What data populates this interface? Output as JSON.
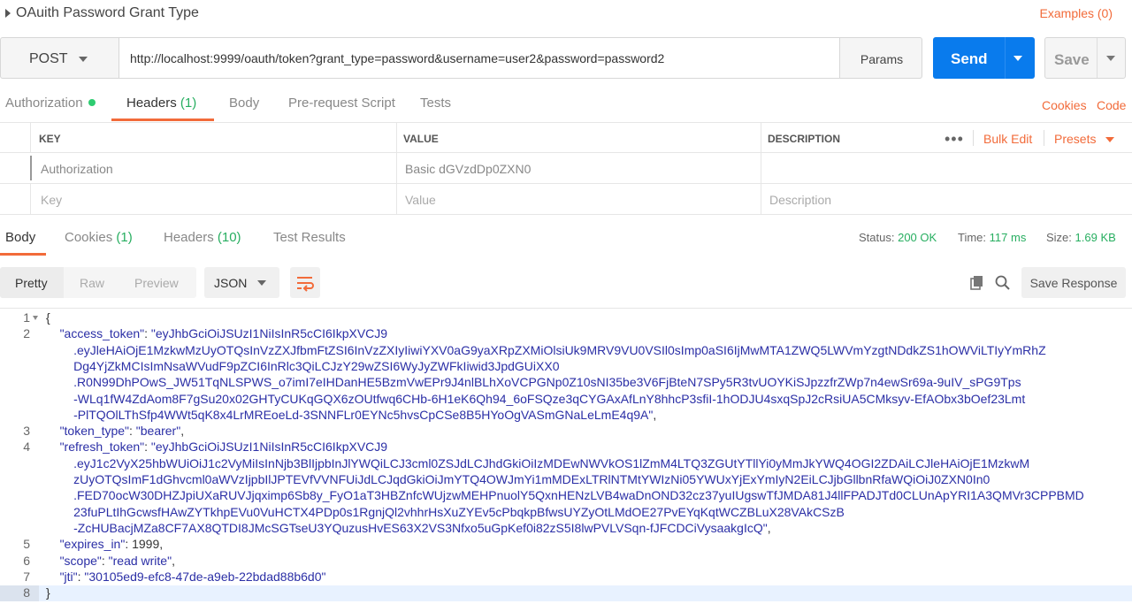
{
  "request": {
    "name": "OAuith Password Grant Type",
    "examples_label": "Examples (0)",
    "method": "POST",
    "url": "http://localhost:9999/oauth/token?grant_type=password&username=user2&password=password2",
    "params_label": "Params",
    "send_label": "Send",
    "save_label": "Save"
  },
  "request_tabs": [
    {
      "label": "Authorization"
    },
    {
      "label": "Headers",
      "count": "(1)"
    },
    {
      "label": "Body"
    },
    {
      "label": "Pre-request Script"
    },
    {
      "label": "Tests"
    }
  ],
  "request_links": {
    "cookies": "Cookies",
    "code": "Code"
  },
  "headers_table": {
    "columns": [
      "KEY",
      "VALUE",
      "DESCRIPTION"
    ],
    "more": "•••",
    "bulk_edit": "Bulk Edit",
    "presets": "Presets",
    "rows": [
      {
        "key": "Authorization",
        "value": "Basic dGVzdDp0ZXN0",
        "description": ""
      }
    ],
    "placeholder": {
      "key": "Key",
      "value": "Value",
      "description": "Description"
    }
  },
  "response_tabs": [
    {
      "label": "Body"
    },
    {
      "label": "Cookies",
      "count": "(1)"
    },
    {
      "label": "Headers",
      "count": "(10)"
    },
    {
      "label": "Test Results"
    }
  ],
  "response_status": {
    "status_label": "Status:",
    "status": "200 OK",
    "time_label": "Time:",
    "time": "117 ms",
    "size_label": "Size:",
    "size": "1.69 KB"
  },
  "response_toolbar": {
    "pretty": "Pretty",
    "raw": "Raw",
    "preview": "Preview",
    "format": "JSON",
    "save_response": "Save Response"
  },
  "response_body": {
    "lines": [
      {
        "n": "1",
        "segments": [
          [
            "p",
            "{"
          ]
        ]
      },
      {
        "n": "2",
        "segments": [
          [
            "p",
            "    "
          ],
          [
            "k",
            "\"access_token\""
          ],
          [
            "p",
            ": "
          ],
          [
            "s",
            "\"eyJhbGciOiJSUzI1NiIsInR5cCI6IkpXVCJ9"
          ]
        ]
      },
      {
        "n": "",
        "segments": [
          [
            "s",
            "        .eyJleHAiOjE1MzkwMzUyOTQsInVzZXJfbmFtZSI6InVzZXIyIiwiYXV0aG9yaXRpZXMiOlsiUk9MRV9VU0VSIl0sImp0aSI6IjMwMTA1ZWQ5LWVmYzgtNDdkZS1hOWViLTIyYmRhZ"
          ]
        ]
      },
      {
        "n": "",
        "segments": [
          [
            "s",
            "        Dg4YjZkMCIsImNsaWVudF9pZCI6InRlc3QiLCJzY29wZSI6WyJyZWFkIiwid3JpdGUiXX0"
          ]
        ]
      },
      {
        "n": "",
        "segments": [
          [
            "s",
            "        .R0N99DhPOwS_JW51TqNLSPWS_o7imI7eIHDanHE5BzmVwEPr9J4nlBLhXoVCPGNp0Z10sNI35be3V6FjBteN7SPy5R3tvUOYKiSJpzzfrZWp7n4ewSr69a-9uIV_sPG9Tps"
          ]
        ]
      },
      {
        "n": "",
        "segments": [
          [
            "s",
            "        -WLq1fW4ZdAom8F7gSu20x02GHTyCUKqGQX6zOUtfwq6CHb-6H1eK6Qh94_6oFSQze3qCYGAxAfLnY8hhcP3sfiI-1hODJU4sxqSpJ2cRsiUA5CMksyv-EfAObx3bOef23Lmt"
          ]
        ]
      },
      {
        "n": "",
        "segments": [
          [
            "s",
            "        -PlTQOlLThSfp4WWt5qK8x4LrMREoeLd-3SNNFLr0EYNc5hvsCpCSe8B5HYoOgVASmGNaLeLmE4q9A\""
          ],
          [
            "p",
            ","
          ]
        ]
      },
      {
        "n": "3",
        "segments": [
          [
            "p",
            "    "
          ],
          [
            "k",
            "\"token_type\""
          ],
          [
            "p",
            ": "
          ],
          [
            "s",
            "\"bearer\""
          ],
          [
            "p",
            ","
          ]
        ]
      },
      {
        "n": "4",
        "segments": [
          [
            "p",
            "    "
          ],
          [
            "k",
            "\"refresh_token\""
          ],
          [
            "p",
            ": "
          ],
          [
            "s",
            "\"eyJhbGciOiJSUzI1NiIsInR5cCI6IkpXVCJ9"
          ]
        ]
      },
      {
        "n": "",
        "segments": [
          [
            "s",
            "        .eyJ1c2VyX25hbWUiOiJ1c2VyMiIsInNjb3BlIjpbInJlYWQiLCJ3cml0ZSJdLCJhdGkiOiIzMDEwNWVkOS1lZmM4LTQ3ZGUtYTllYi0yMmJkYWQ4OGI2ZDAiLCJleHAiOjE1MzkwM"
          ]
        ]
      },
      {
        "n": "",
        "segments": [
          [
            "s",
            "        zUyOTQsImF1dGhvcml0aWVzIjpbIlJPTEVfVVNFUiJdLCJqdGkiOiJmYTQ4OWJmYi1mMDExLTRlNTMtYWIzNi05YWUxYjExYmIyN2EiLCJjbGllbnRfaWQiOiJ0ZXN0In0"
          ]
        ]
      },
      {
        "n": "",
        "segments": [
          [
            "s",
            "        .FED70ocW30DHZJpiUXaRUVJjqximp6Sb8y_FyO1aT3HBZnfcWUjzwMEHPnuolY5QxnHENzLVB4waDnOND32cz37yuIUgswTfJMDA81J4llFPADJTd0CLUnApYRI1A3QMVr3CPPBMD"
          ]
        ]
      },
      {
        "n": "",
        "segments": [
          [
            "s",
            "        23fuPLtIhGcwsfHAwZYTkhpEVu0VuHCTX4PDp0s1RgnjQl2vhhrHsXuZYEv5cPbqkpBfwsUYZyOtLMdOE27PvEYqKqtWCZBLuX28VAkCSzB"
          ]
        ]
      },
      {
        "n": "",
        "segments": [
          [
            "s",
            "        -ZcHUBacjMZa8CF7AX8QTDI8JMcSGTseU3YQuzusHvES63X2VS3Nfxo5uGpKef0i82zS5I8lwPVLVSqn-fJFCDCiVysaakgIcQ\""
          ],
          [
            "p",
            ","
          ]
        ]
      },
      {
        "n": "5",
        "segments": [
          [
            "p",
            "    "
          ],
          [
            "k",
            "\"expires_in\""
          ],
          [
            "p",
            ": 1999,"
          ]
        ]
      },
      {
        "n": "6",
        "segments": [
          [
            "p",
            "    "
          ],
          [
            "k",
            "\"scope\""
          ],
          [
            "p",
            ": "
          ],
          [
            "s",
            "\"read write\""
          ],
          [
            "p",
            ","
          ]
        ]
      },
      {
        "n": "7",
        "segments": [
          [
            "p",
            "    "
          ],
          [
            "k",
            "\"jti\""
          ],
          [
            "p",
            ": "
          ],
          [
            "s",
            "\"30105ed9-efc8-47de-a9eb-22bdad88b6d0\""
          ]
        ]
      },
      {
        "n": "8",
        "segments": [
          [
            "p",
            "}"
          ]
        ]
      }
    ]
  },
  "colors": {
    "accent": "#f26b3a",
    "send": "#097bed",
    "success": "#27ae60",
    "json_string": "#2b2fa6"
  },
  "icons": [
    "collapse-triangle-icon",
    "chevron-down-icon",
    "wrap-lines-icon",
    "copy-icon",
    "search-icon",
    "fold-arrow-icon"
  ]
}
